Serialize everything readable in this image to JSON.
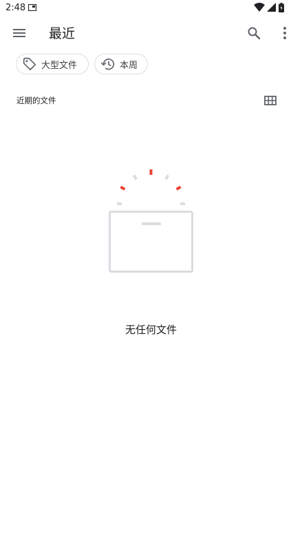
{
  "status_bar": {
    "time": "2:48"
  },
  "app_bar": {
    "title": "最近",
    "menu_icon": "menu-icon",
    "search_icon": "search-icon",
    "more_icon": "more-vert-icon"
  },
  "chips": [
    {
      "label": "大型文件",
      "icon": "tag-icon"
    },
    {
      "label": "本周",
      "icon": "history-icon"
    }
  ],
  "section": {
    "title": "近期的文件",
    "view_toggle_icon": "grid-view-icon"
  },
  "empty_state": {
    "message": "无任何文件"
  },
  "colors": {
    "accent_red": "#ea4335",
    "text_primary": "#202124",
    "chip_border": "#dadce0",
    "illustration_gray": "#dadce0"
  }
}
